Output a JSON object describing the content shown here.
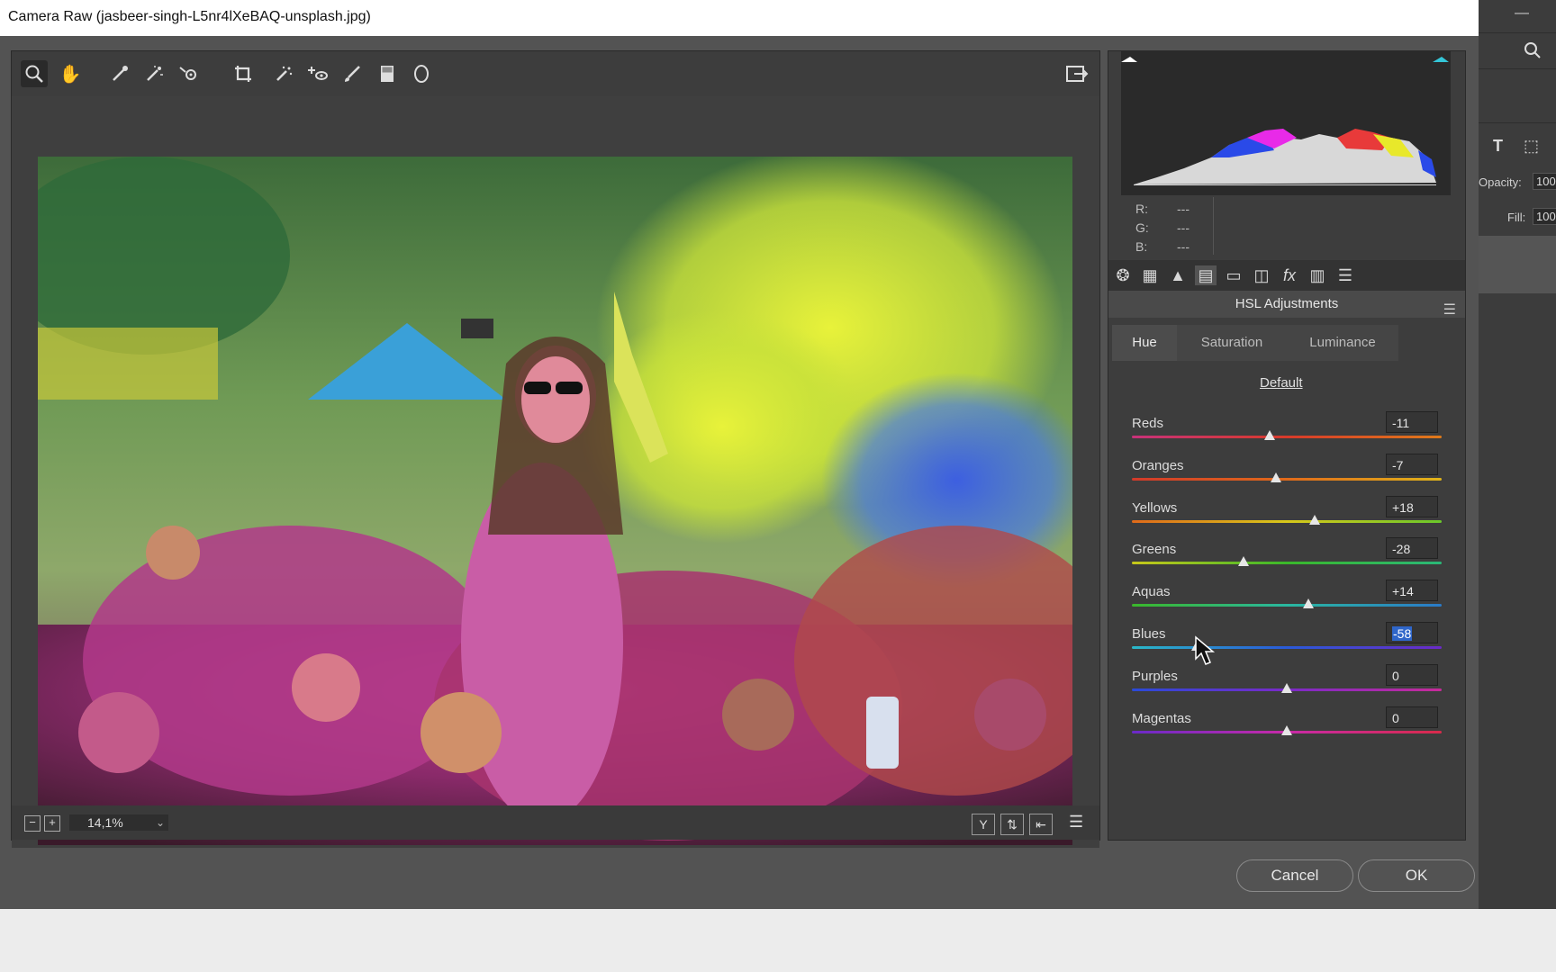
{
  "window": {
    "title": "Camera Raw (jasbeer-singh-L5nr4lXeBAQ-unsplash.jpg)"
  },
  "toolbar": {
    "tools": [
      "zoom-icon",
      "hand-icon",
      "white-balance-icon",
      "color-sampler-icon",
      "targeted-adjustment-icon",
      "crop-icon",
      "straighten-icon",
      "spot-removal-icon",
      "red-eye-icon",
      "adjustment-brush-icon",
      "graduated-filter-icon",
      "radial-filter-icon"
    ],
    "export_icon": "open-preferences-icon"
  },
  "histogram": {
    "r_label": "R:",
    "g_label": "G:",
    "b_label": "B:",
    "r_value": "---",
    "g_value": "---",
    "b_value": "---"
  },
  "panel": {
    "title": "HSL Adjustments",
    "tabs": [
      "Hue",
      "Saturation",
      "Luminance"
    ],
    "active_tab": "Hue",
    "default_link": "Default"
  },
  "sliders": [
    {
      "label": "Reds",
      "value": "-11",
      "colors": [
        "#c8327a",
        "#d83a2a",
        "#e07a1a"
      ]
    },
    {
      "label": "Oranges",
      "value": "-7",
      "colors": [
        "#d23a2a",
        "#e06a1a",
        "#e0b41a"
      ]
    },
    {
      "label": "Yellows",
      "value": "+18",
      "colors": [
        "#e06a1a",
        "#d8c81a",
        "#6ac82a"
      ]
    },
    {
      "label": "Greens",
      "value": "-28",
      "colors": [
        "#c8c81a",
        "#3ab82a",
        "#2ab878"
      ]
    },
    {
      "label": "Aquas",
      "value": "+14",
      "colors": [
        "#3ab82a",
        "#2ab8a0",
        "#2a7ac8"
      ]
    },
    {
      "label": "Blues",
      "value": "-58",
      "colors": [
        "#2ab8c8",
        "#2a5ad8",
        "#6a2ac8"
      ]
    },
    {
      "label": "Purples",
      "value": "0",
      "colors": [
        "#2a4ad8",
        "#7a2ac8",
        "#c82a9a"
      ]
    },
    {
      "label": "Magentas",
      "value": "0",
      "colors": [
        "#6a2ac8",
        "#c82aa8",
        "#d82a4a"
      ]
    }
  ],
  "slider_levels": [
    -11,
    -7,
    18,
    -28,
    14,
    -58,
    0,
    0
  ],
  "selected_slider": "Blues",
  "bottom": {
    "zoom": "14,1%",
    "cancel": "Cancel",
    "ok": "OK"
  },
  "background_app": {
    "opacity_label": "Opacity:",
    "opacity_value": "100",
    "fill_label": "Fill:",
    "fill_value": "100"
  }
}
